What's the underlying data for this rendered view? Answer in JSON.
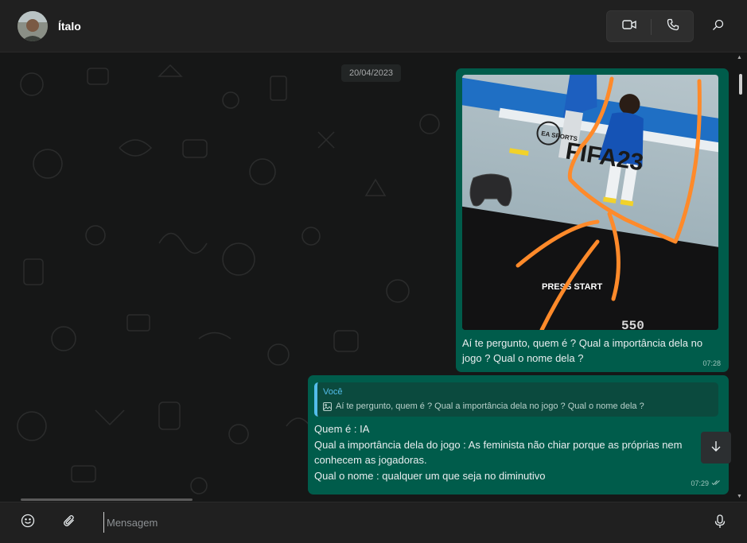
{
  "header": {
    "contact_name": "Ítalo",
    "icons": {
      "video": "video-camera-icon",
      "voice": "phone-icon",
      "search": "search-icon"
    }
  },
  "chat": {
    "date_divider": "20/04/2023",
    "messages": [
      {
        "type": "image",
        "image_text": {
          "brand": "EA SPORTS",
          "game": "FIFA23",
          "prompt": "PRESS START",
          "counter": "550"
        },
        "caption": "Aí te pergunto, quem é ? Qual a importância dela no jogo ? Qual o nome dela ?",
        "time": "07:28"
      },
      {
        "type": "reply",
        "quote_author": "Você",
        "quote_text": "Aí te pergunto, quem é ? Qual a importância dela no jogo ? Qual o nome dela ?",
        "lines": [
          "Quem é : IA",
          "Qual a importância dela do jogo : As feminista não chiar porque as próprias nem",
          "conhecem as jogadoras.",
          "Qual o nome : qualquer um que seja no diminutivo"
        ],
        "time": "07:29",
        "status": "read-double-check-icon"
      }
    ]
  },
  "composer": {
    "placeholder": "Mensagem",
    "value": "",
    "icons": {
      "emoji": "emoji-icon",
      "attach": "paperclip-icon",
      "mic": "microphone-icon"
    }
  },
  "colors": {
    "outgoing_bubble": "#005c4b",
    "quote_bar": "#53bdeb",
    "header_bg": "#202020",
    "chat_bg": "#161717",
    "annotation_orange": "#ff8a2a"
  }
}
